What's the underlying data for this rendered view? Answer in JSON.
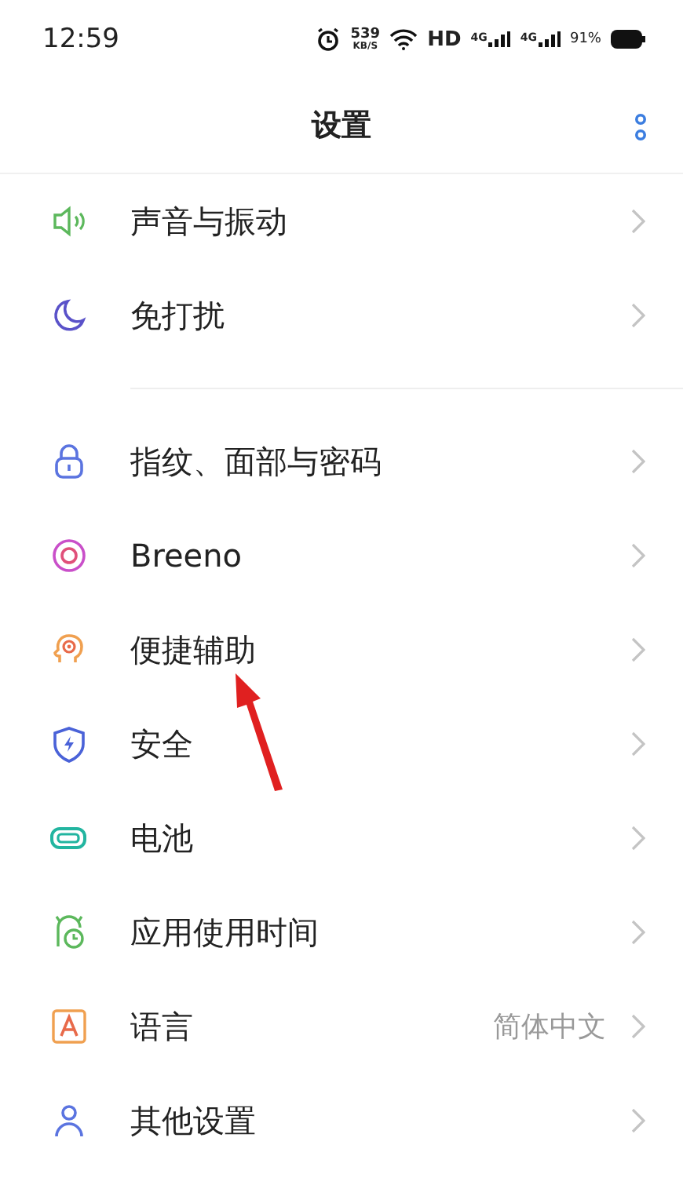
{
  "status_bar": {
    "time": "12:59",
    "speed": "539",
    "speed_unit": "KB/S",
    "hd": "HD",
    "network_1": "4G",
    "network_2": "4G",
    "battery": "91%"
  },
  "header": {
    "title": "设置"
  },
  "groups": [
    {
      "items": [
        {
          "label": "声音与振动"
        },
        {
          "label": "免打扰"
        }
      ]
    },
    {
      "items": [
        {
          "label": "指纹、面部与密码"
        },
        {
          "label": "Breeno"
        },
        {
          "label": "便捷辅助"
        },
        {
          "label": "安全"
        },
        {
          "label": "电池"
        },
        {
          "label": "应用使用时间"
        },
        {
          "label": "语言",
          "value": "简体中文"
        },
        {
          "label": "其他设置"
        }
      ]
    }
  ],
  "annotation": {
    "kind": "arrow"
  }
}
